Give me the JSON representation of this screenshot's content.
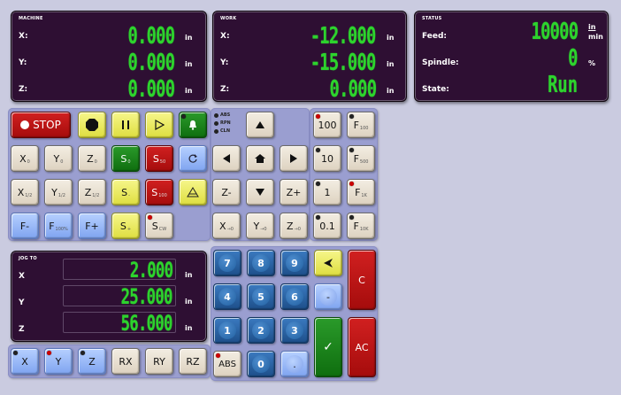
{
  "machine": {
    "title": "MACHINE",
    "rows": [
      {
        "label": "X:",
        "value": "0.000",
        "unit": "in"
      },
      {
        "label": "Y:",
        "value": "0.000",
        "unit": "in"
      },
      {
        "label": "Z:",
        "value": "0.000",
        "unit": "in"
      }
    ]
  },
  "work": {
    "title": "WORK",
    "rows": [
      {
        "label": "X:",
        "value": "-12.000",
        "unit": "in"
      },
      {
        "label": "Y:",
        "value": "-15.000",
        "unit": "in"
      },
      {
        "label": "Z:",
        "value": "0.000",
        "unit": "in"
      }
    ]
  },
  "status": {
    "title": "STATUS",
    "feed_label": "Feed:",
    "feed_value": "10000",
    "feed_unit_top": "in",
    "feed_unit_bottom": "min",
    "spindle_label": "Spindle:",
    "spindle_value": "0",
    "spindle_unit": "%",
    "state_label": "State:",
    "state_value": "Run"
  },
  "controls": {
    "stop": "STOP",
    "ind_abs": "ABS",
    "ind_rpn": "RPN",
    "ind_cln": "CLN",
    "f_minus": "F-",
    "f_plus": "F+",
    "z_minus": "Z-",
    "z_plus": "Z+"
  },
  "axis_zero": {
    "x": "X",
    "y": "Y",
    "z": "Z",
    "sub0": "0",
    "sub_half": "1/2",
    "sub_to0": "→0"
  },
  "spindle_btns": {
    "s": "S",
    "s0": "0",
    "s50": "50",
    "s_minus": "-",
    "s100": "100",
    "s_plus": "+",
    "scw": "CW"
  },
  "feed_pct": {
    "f": "F",
    "sub": "100%"
  },
  "step": {
    "s100": "100",
    "s10": "10",
    "s1": "1",
    "s01": "0.1"
  },
  "feed_ovr": {
    "f": "F",
    "f100": "100",
    "f500": "500",
    "f1k": "1K",
    "f10k": "10K"
  },
  "jog": {
    "title": "JOG TO",
    "rows": [
      {
        "label": "X",
        "value": "2.000",
        "unit": "in"
      },
      {
        "label": "Y",
        "value": "25.000",
        "unit": "in"
      },
      {
        "label": "Z",
        "value": "56.000",
        "unit": "in"
      }
    ]
  },
  "keypad": {
    "k7": "7",
    "k8": "8",
    "k9": "9",
    "k4": "4",
    "k5": "5",
    "k6": "6",
    "k1": "1",
    "k2": "2",
    "k3": "3",
    "k0": "0",
    "abs": "ABS",
    "dot": ".",
    "minus": "-",
    "clear": "C",
    "all_clear": "AC",
    "enter": "✓"
  },
  "axis_select": {
    "x": "X",
    "y": "Y",
    "z": "Z",
    "rx": "RX",
    "ry": "RY",
    "rz": "RZ"
  }
}
